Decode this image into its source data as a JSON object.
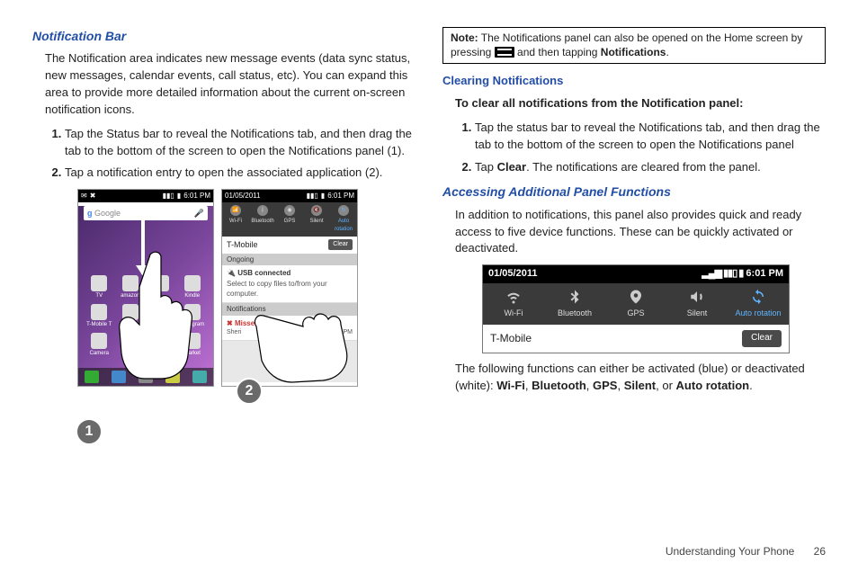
{
  "left": {
    "heading": "Notification Bar",
    "para": "The Notification area indicates new message events (data sync status, new messages, calendar events, call status, etc). You can expand this area to provide more detailed information about the current on-screen notification icons.",
    "step1": "Tap the Status bar to reveal the Notifications tab, and then drag the tab to the bottom of the screen to open the Notifications panel (1).",
    "step2": "Tap a notification entry to open the associated application (2)."
  },
  "right": {
    "note_label": "Note:",
    "note_line1": "The Notifications panel can also be opened on the Home screen by pressing ",
    "note_line2": " and then tapping ",
    "note_bold": "Notifications",
    "note_end": ".",
    "clear_heading": "Clearing Notifications",
    "clear_intro": "To clear all notifications from the Notification panel:",
    "clear_step1": "Tap the status bar to reveal the Notifications tab, and then drag the tab to the bottom of the screen to open the Notifications panel",
    "clear_step2a": "Tap ",
    "clear_step2b": "Clear",
    "clear_step2c": ". The notifications are cleared from the panel.",
    "access_heading": "Accessing Additional Panel Functions",
    "access_para": "In addition to notifications, this panel also provides quick and ready access to five device functions. These can be quickly activated or deactivated.",
    "closing_a": "The following functions can either be activated (blue) or deactivated (white): ",
    "f1": "Wi-Fi",
    "c1": ", ",
    "f2": "Bluetooth",
    "c2": ", ",
    "f3": "GPS",
    "c3": ", ",
    "f4": "Silent",
    "c4": ", or ",
    "f5": "Auto rotation",
    "c5": "."
  },
  "figure1": {
    "status_time": "6:01 PM",
    "date": "01/05/2011",
    "search_placeholder": "Google",
    "apps": [
      "TV",
      "amazon",
      "",
      "Kindle",
      "T-Mobile T",
      "",
      "",
      "Instagram",
      "Camera",
      "",
      "",
      "Market"
    ],
    "toggles": [
      "Wi-Fi",
      "Bluetooth",
      "GPS",
      "Silent",
      "Auto rotation"
    ],
    "carrier": "T-Mobile",
    "clear": "Clear",
    "section_ongoing": "Ongoing",
    "usb_title": "USB connected",
    "usb_sub": "Select to copy files to/from your computer.",
    "section_notifications": "Notifications",
    "missed_title": "Missed call",
    "missed_name": "Sheri",
    "missed_time": "3:06 PM",
    "badge1": "1",
    "badge2": "2"
  },
  "figure2": {
    "date": "01/05/2011",
    "time": "6:01 PM",
    "toggles": [
      "Wi-Fi",
      "Bluetooth",
      "GPS",
      "Silent",
      "Auto rotation"
    ],
    "carrier": "T-Mobile",
    "clear": "Clear"
  },
  "footer": {
    "section": "Understanding Your Phone",
    "page": "26"
  },
  "chart_data": null
}
